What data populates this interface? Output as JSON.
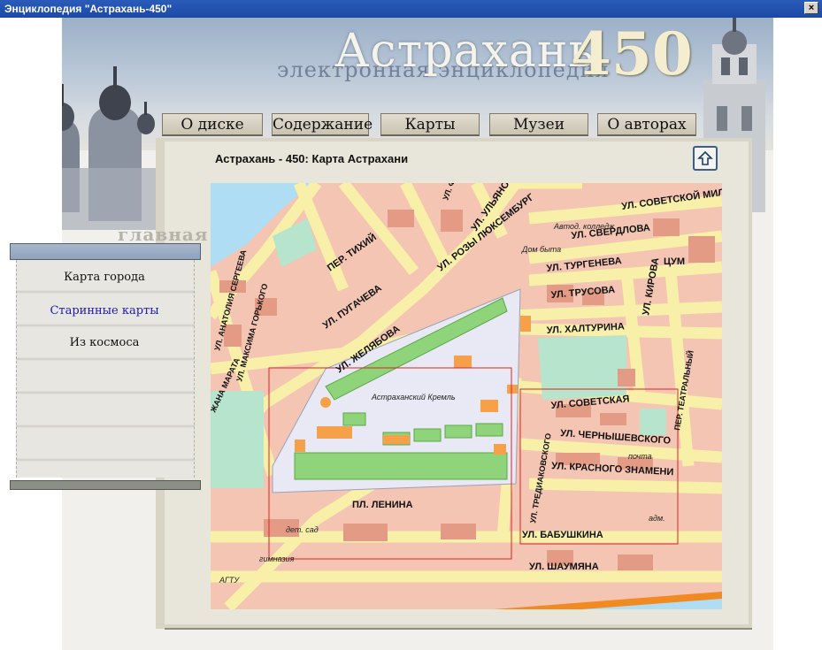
{
  "window": {
    "title": "Энциклопедия \"Астрахань-450\"",
    "close_label": "×"
  },
  "banner": {
    "title": "Астрахань",
    "subtitle": "электронная энциклопедия",
    "number": "450"
  },
  "tabs": [
    {
      "label": "О диске"
    },
    {
      "label": "Содержание"
    },
    {
      "label": "Карты"
    },
    {
      "label": "Музеи"
    },
    {
      "label": "О авторах"
    }
  ],
  "page": {
    "title": "Астрахань - 450: Карта Астрахани"
  },
  "sidebar": {
    "heading": "главная",
    "items": [
      {
        "label": "Карта города",
        "color": "#111111"
      },
      {
        "label": "Старинные карты",
        "color": "#1a1ab0"
      },
      {
        "label": "Из космоса",
        "color": "#111111"
      }
    ]
  },
  "map": {
    "labels": [
      "УЛ. СОВЕТСКОЙ МИЛИЦИИ",
      "УЛ. СВЕРДЛОВА",
      "УЛ. ТУРГЕНЕВА",
      "УЛ. ТРУСОВА",
      "УЛ. ХАЛТУРИНА",
      "УЛ. СОВЕТСКАЯ",
      "УЛ. ЧЕРНЫШЕВСКОГО",
      "УЛ. КРАСНОГО ЗНАМЕНИ",
      "УЛ. БАБУШКИНА",
      "УЛ. ШАУМЯНА",
      "ПЛ. ЛЕНИНА",
      "ПЕР. ТИХИЙ",
      "УЛ. ПУГАЧЕВА",
      "УЛ. ЖЕЛЯБОВА",
      "УЛ. РОЗЫ ЛЮКСЕМБУРГ",
      "УЛ. УЛЬЯНОВЫХ",
      "УЛ. КИРОВА",
      "ЦУМ",
      "Астраханский Кремль",
      "Автод. колледж",
      "Дом быта",
      "дет. сад",
      "гимназия",
      "АГТУ",
      "почта",
      "адм.",
      "ПЕР. ТЕАТРАЛЬНЫЙ",
      "УЛ. ТРЕДИАКОВСКОГО",
      "УЛ. МАКСИМА ГОРЬКОГО",
      "УЛ. АНАТОЛИЯ СЕРГЕЕВА",
      "ЖАНА МАРАТА",
      "УЛ. ФИОЛЕТОВА"
    ]
  }
}
